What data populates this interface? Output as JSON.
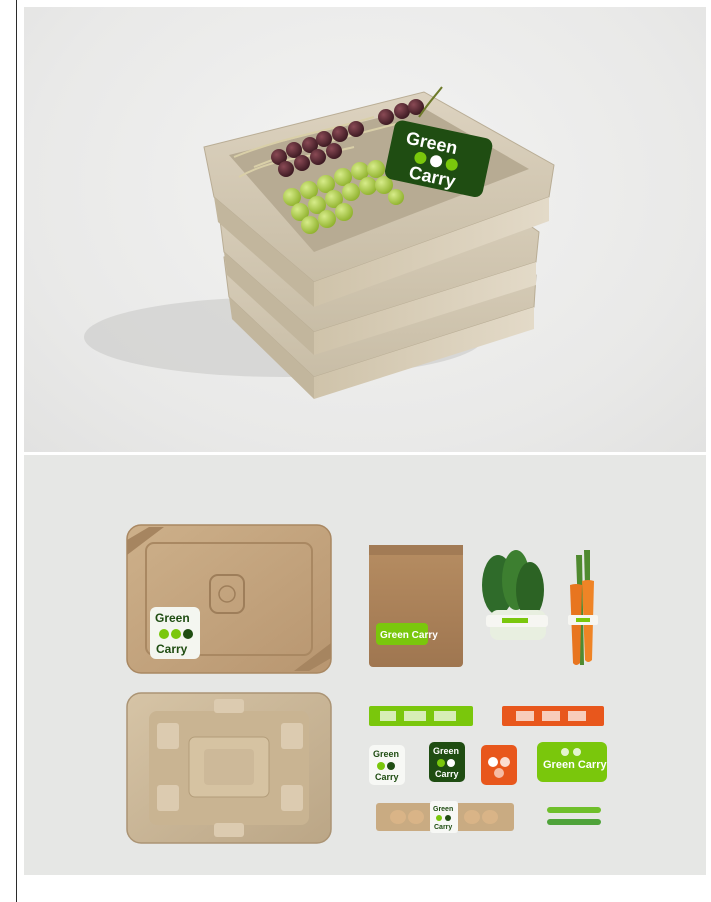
{
  "brand": {
    "word1": "Green",
    "word2": "Carry",
    "wordmark": "Green Carry",
    "accent_color": "#7ac70c",
    "dark_color": "#1f4d12",
    "orange_color": "#e8571c"
  },
  "top_photo": {
    "subject": "stacked pulp trays"
  },
  "bottom_photo": {
    "subject": "packaging flat lay"
  }
}
